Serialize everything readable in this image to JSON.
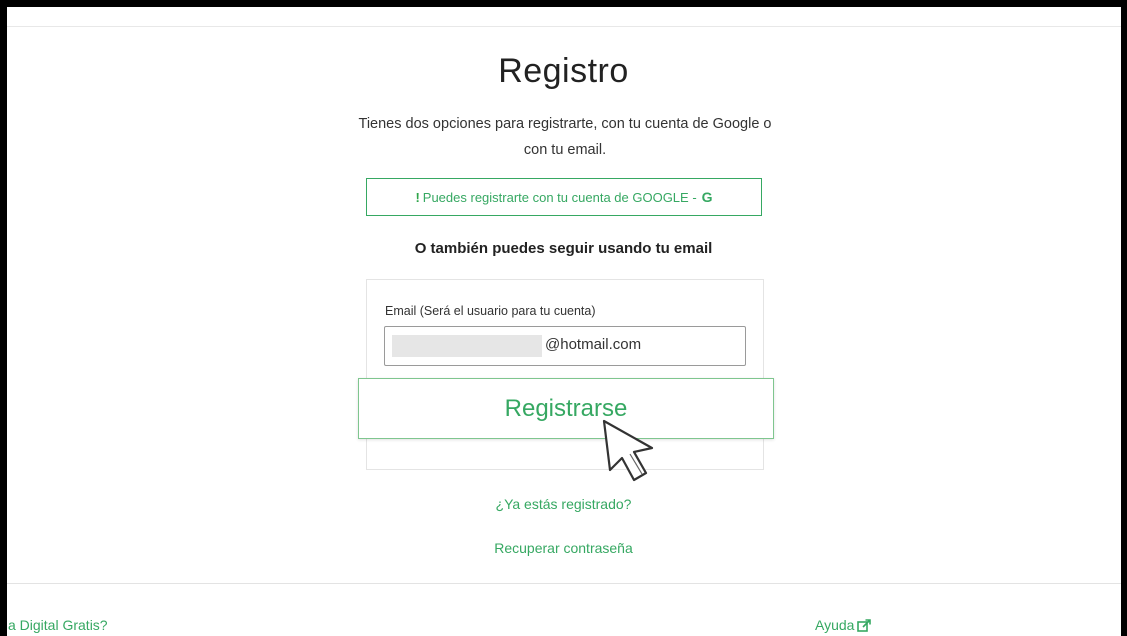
{
  "page": {
    "title": "Registro",
    "subtitle": "Tienes dos opciones para registrarte, con tu cuenta de Google o con tu email."
  },
  "google": {
    "label": "Puedes registrarte con tu cuenta de GOOGLE -",
    "icon": "google-icon",
    "icon_glyph": "G",
    "excl": "!"
  },
  "alt_heading": "O también puedes seguir usando tu email",
  "form": {
    "email_label": "Email (Será el usuario para tu cuenta)",
    "email_value": "@hotmail.com",
    "submit_label": "Registrarse"
  },
  "links": {
    "registered": "¿Ya estás registrado?",
    "recover": "Recuperar contraseña"
  },
  "footer": {
    "left_text": "a Digital Gratis?",
    "help_label": "Ayuda",
    "help_icon": "external-link-icon"
  },
  "colors": {
    "accent": "#36a862",
    "border": "#e4e4e4"
  }
}
